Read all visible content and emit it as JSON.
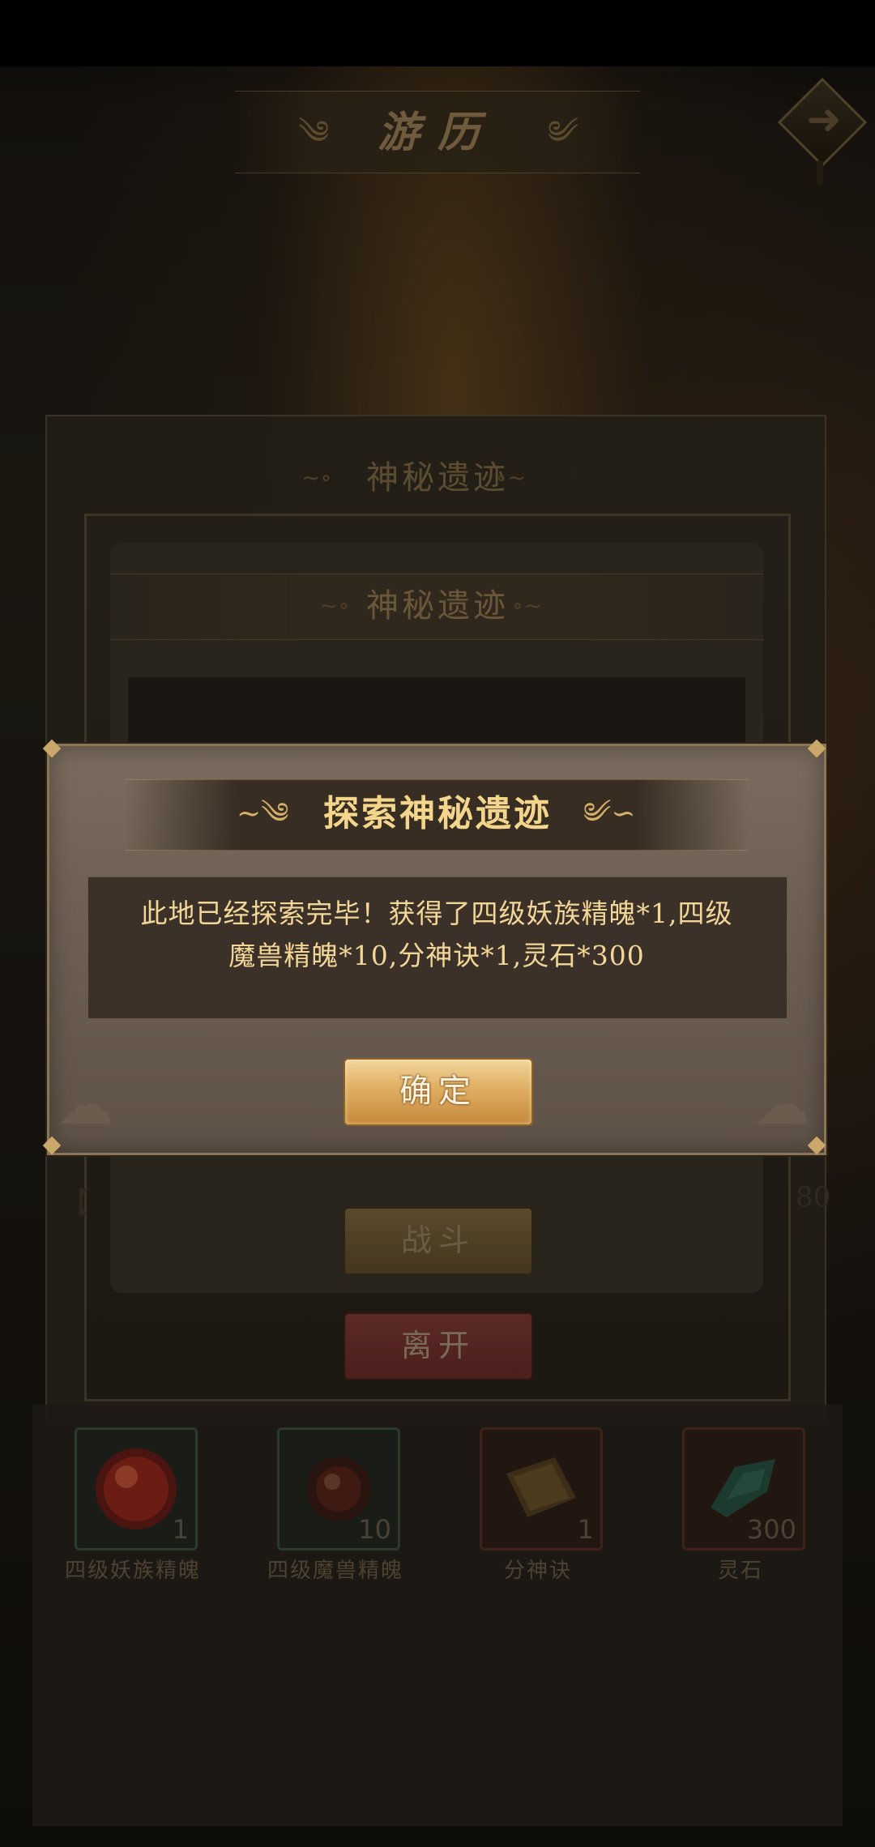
{
  "header": {
    "title": "游历",
    "next_icon": "arrow-right-icon"
  },
  "outer_panel": {
    "title": "神秘遗迹"
  },
  "mid_dialog": {
    "title": "神秘遗迹",
    "fight_label": "战斗",
    "leave_label": "离开",
    "side_bracket": "【",
    "side_number": "80"
  },
  "modal": {
    "title": "探索神秘遗迹",
    "message_line1": "此地已经探索完毕！获得了四级妖族精魄*1,四级",
    "message_line2": "魔兽精魄*10,分神诀*1,灵石*300",
    "confirm_label": "确定"
  },
  "rewards": [
    {
      "name": "四级妖族精魄",
      "count": "1",
      "icon": "red-orb-icon",
      "color": "#b3271a"
    },
    {
      "name": "四级魔兽精魄",
      "count": "10",
      "icon": "dark-orb-icon",
      "color": "#6b2418"
    },
    {
      "name": "分神诀",
      "count": "1",
      "icon": "book-icon",
      "color": "#8a6a2a"
    },
    {
      "name": "灵石",
      "count": "300",
      "icon": "spirit-stone-icon",
      "color": "#2f8a66"
    }
  ],
  "colors": {
    "accent_gold": "#f3d58c",
    "confirm_button": "#dfae62",
    "leave_button": "#5c2a26"
  }
}
